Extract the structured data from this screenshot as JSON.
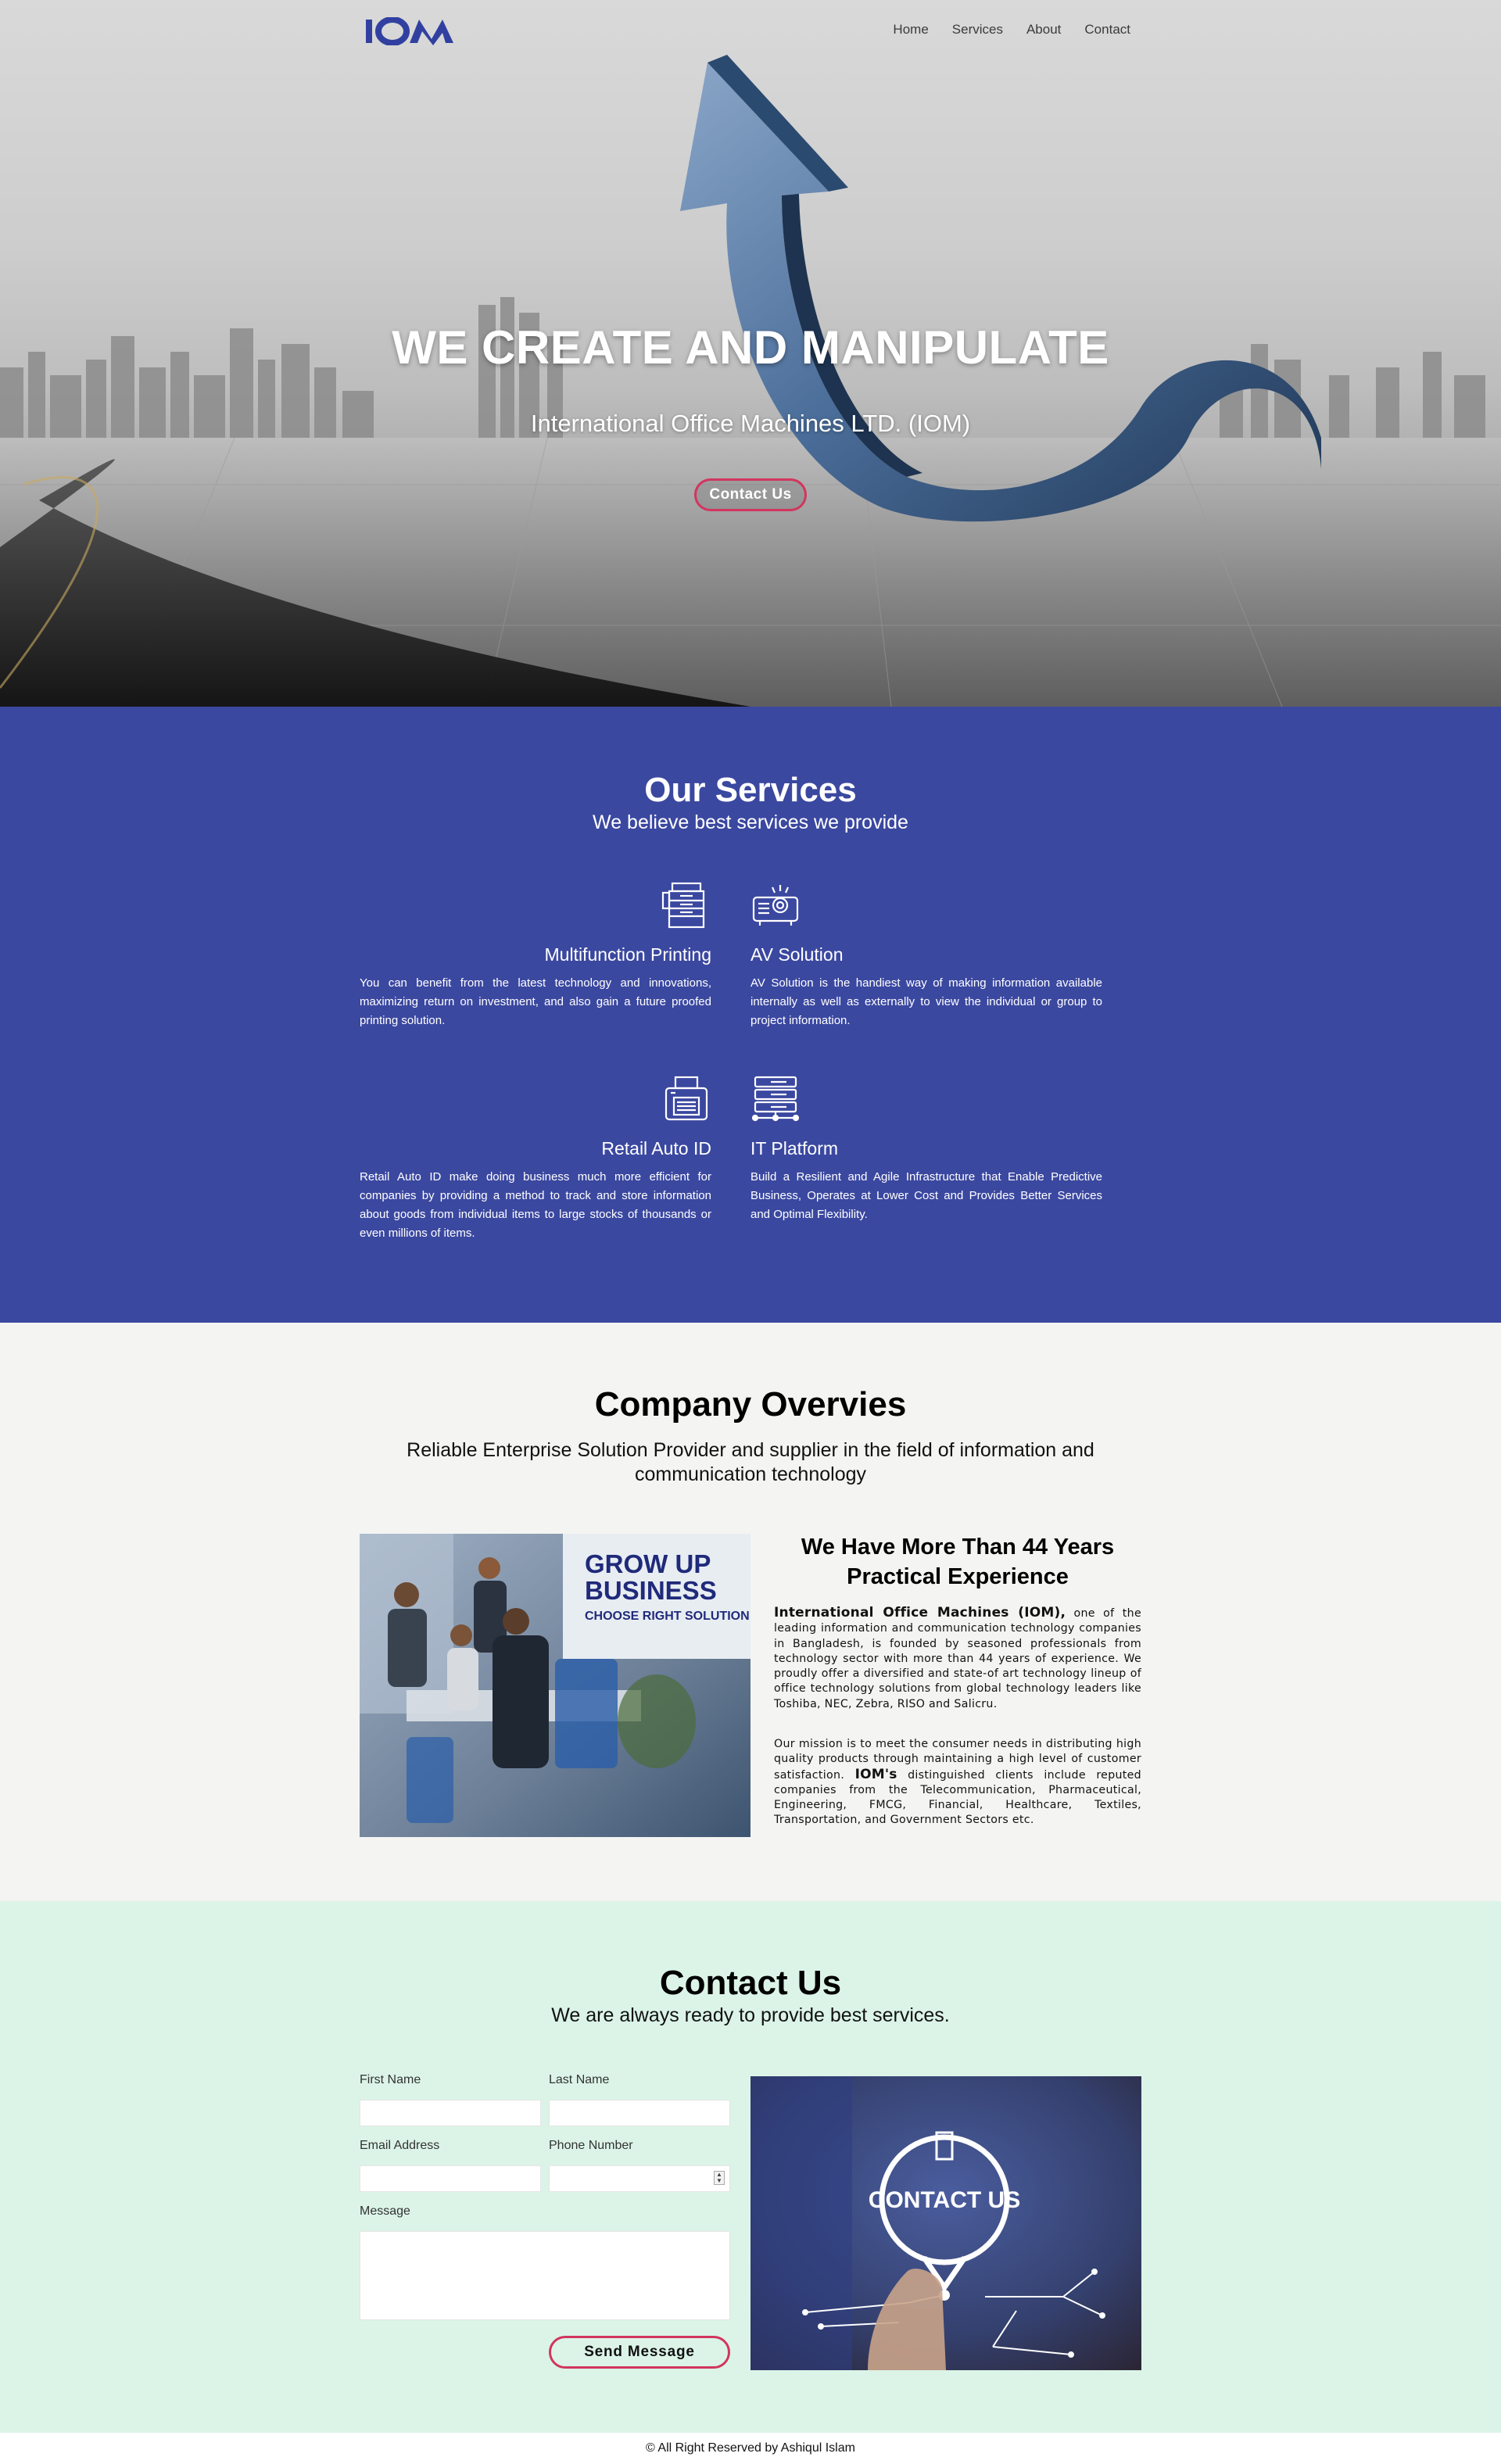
{
  "brand": {
    "logo_text": "IOM"
  },
  "nav": {
    "items": [
      "Home",
      "Services",
      "About",
      "Contact"
    ]
  },
  "hero": {
    "title": "WE CREATE AND MANIPULATE",
    "subtitle": "International Office Machines LTD. (IOM)",
    "cta_label": "Contact Us"
  },
  "services": {
    "title": "Our Services",
    "subtitle": "We believe best services we provide",
    "items": [
      {
        "name": "Multifunction Printing",
        "icon": "printer-stack-icon",
        "description": "You can benefit from the latest technology and innovations, maximizing return on investment, and also gain a future proofed printing solution."
      },
      {
        "name": "AV Solution",
        "icon": "projector-icon",
        "description": "AV Solution is the handiest way of making information available internally as well as externally to view the individual or group to project information."
      },
      {
        "name": "Retail Auto ID",
        "icon": "label-printer-icon",
        "description": "Retail Auto ID make doing business much more efficient for companies by providing a method to track and store information about goods from individual items to large stocks of thousands or even millions of items."
      },
      {
        "name": "IT Platform",
        "icon": "server-rack-icon",
        "description": "Build a Resilient and Agile Infrastructure that Enable Predictive Business, Operates at Lower Cost and Provides Better Services and Optimal Flexibility."
      }
    ]
  },
  "overview": {
    "title": "Company Overvies",
    "subtitle": "Reliable Enterprise Solution Provider and supplier in the field of information and communication technology",
    "image": {
      "line1": "GROW UP",
      "line2": "BUSINESS",
      "line3": "CHOOSE RIGHT SOLUTION"
    },
    "heading": "We Have More Than 44 Years Practical Experience",
    "p1_strong": "International Office Machines (IOM),",
    "p1_rest": " one of the leading information and communication technology companies in Bangladesh, is founded by seasoned professionals from technology sector with more than 44 years of experience. We proudly offer a diversified and state-of art technology lineup of office technology solutions from global technology leaders like Toshiba, NEC, Zebra, RISO and Salicru.",
    "p2_start": "Our mission is to meet the consumer needs in distributing high quality products through maintaining a high level of customer satisfaction. ",
    "p2_strong": "IOM's",
    "p2_rest": " distinguished clients include reputed companies from the Telecommunication, Pharmaceutical, Engineering, FMCG, Financial, Healthcare, Textiles, Transportation, and Government Sectors etc."
  },
  "contact": {
    "title": "Contact Us",
    "subtitle": "We are always ready to provide best services.",
    "labels": {
      "first_name": "First Name",
      "last_name": "Last Name",
      "email": "Email Address",
      "phone": "Phone Number",
      "message": "Message"
    },
    "values": {
      "first_name": "",
      "last_name": "",
      "email": "",
      "phone": "",
      "message": ""
    },
    "send_label": "Send Message",
    "image_text": "CONTACT US"
  },
  "footer": {
    "text": "© All Right Reserved by Ashiqul Islam"
  },
  "colors": {
    "primary": "#3b48a0",
    "accent": "#d2355e",
    "overview_bg": "#f4f4f2",
    "contact_bg": "#dbf4e7"
  }
}
